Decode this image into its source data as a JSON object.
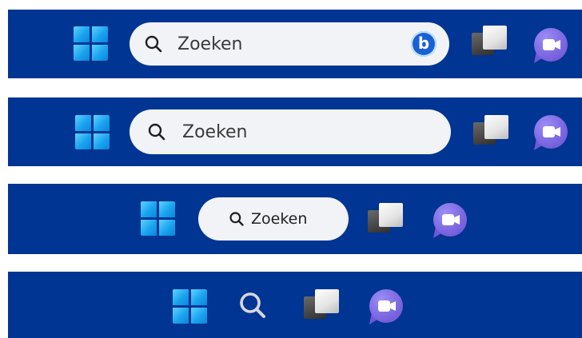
{
  "taskbars": [
    {
      "variant": "search-box-with-bing",
      "search": {
        "label": "Zoeken"
      },
      "bing_icon": "bing-chat-icon"
    },
    {
      "variant": "search-box",
      "search": {
        "label": "Zoeken"
      }
    },
    {
      "variant": "search-compact",
      "search": {
        "label": "Zoeken"
      }
    },
    {
      "variant": "search-icon-only"
    }
  ],
  "icons": {
    "start": "windows-start-icon",
    "search": "search-icon",
    "task_view": "task-view-icon",
    "meet": "teams-meet-icon"
  },
  "colors": {
    "taskbar": "#003593",
    "search_box": "#f1f3f7",
    "start_logo": "#1aa3ee",
    "meet_accent": "#7f6be4"
  }
}
